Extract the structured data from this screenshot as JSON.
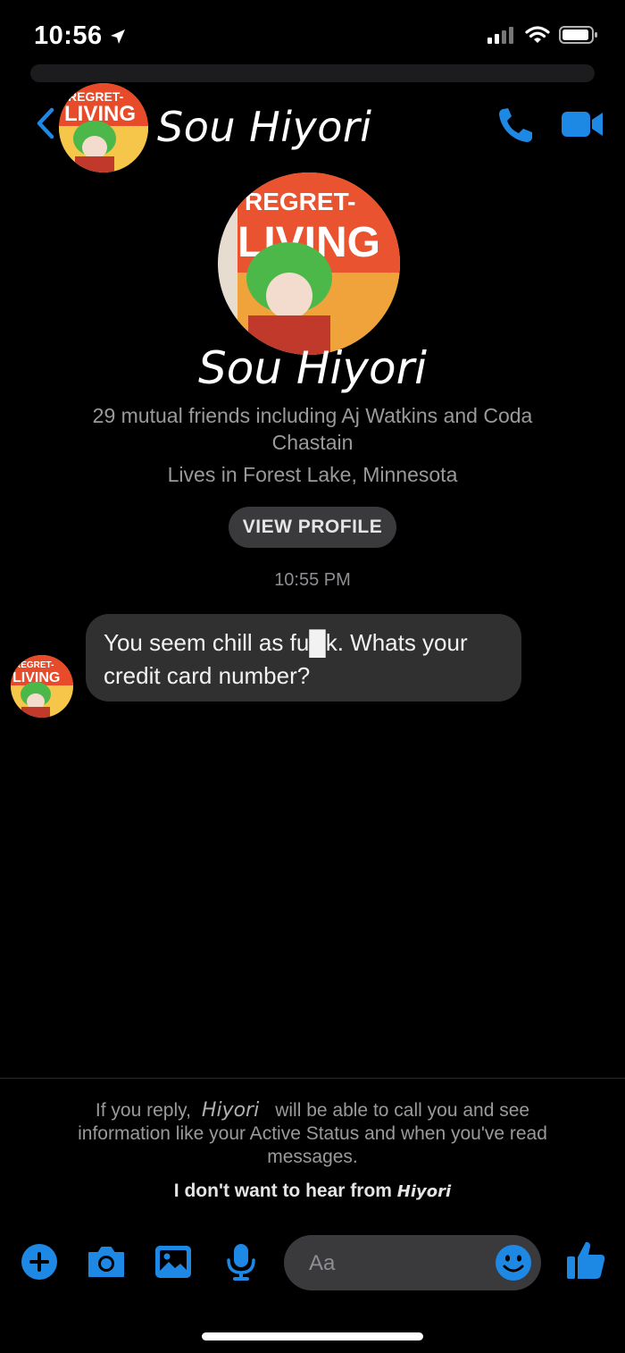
{
  "status_bar": {
    "time": "10:56"
  },
  "header": {
    "name": "Sou Hiyori"
  },
  "profile": {
    "name": "Sou Hiyori",
    "avatar_text_top": "REGRET-",
    "avatar_text_main": "LIVING",
    "mutual_friends": "29 mutual friends including Aj Watkins and Coda Chastain",
    "lives_in": "Lives in Forest Lake, Minnesota",
    "view_profile_label": "VIEW PROFILE"
  },
  "conversation": {
    "timestamp": "10:55 PM",
    "messages": [
      {
        "text": "You seem chill as fu█k. Whats your credit card number?"
      }
    ]
  },
  "request_notice": {
    "prefix": "If you reply,",
    "name": "Hiyori",
    "suffix": "will be able to call you and see information like your Active Status and when you've read messages.",
    "block_prefix": "I don't want to hear from",
    "block_name": "Hiyori"
  },
  "composer": {
    "placeholder": "Aa"
  },
  "icons": {
    "back": "chevron-left-icon",
    "call": "phone-icon",
    "video": "video-camera-icon",
    "add": "plus-circle-icon",
    "camera": "camera-icon",
    "gallery": "image-icon",
    "mic": "microphone-icon",
    "emoji": "smiley-icon",
    "like": "thumbs-up-icon"
  },
  "colors": {
    "accent": "#1e88e5",
    "background": "#000000",
    "bubble": "#303030"
  }
}
